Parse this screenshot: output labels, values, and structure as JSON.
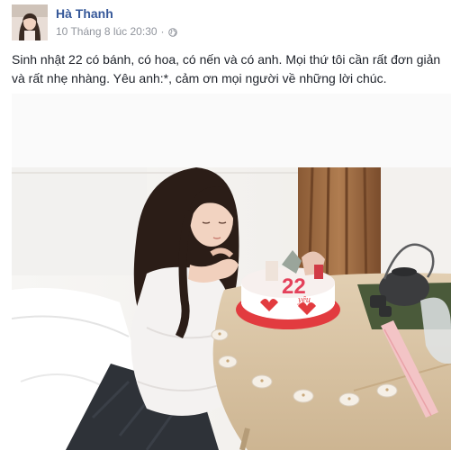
{
  "post": {
    "author": "Hà Thanh",
    "timestamp": "10 Tháng 8 lúc 20:30",
    "separator": "·",
    "privacy_icon": "globe-icon",
    "text_lines": [
      "Sinh nhật 22 có bánh, có hoa, có nến và có anh. Mọi thứ tôi cần rất đơn giản",
      "và rất nhẹ nhàng. Yêu anh:*, cảm ơn mọi người về những lời chúc."
    ]
  },
  "photo": {
    "cake_number": "22",
    "cake_text": "yêu"
  },
  "colors": {
    "author_link": "#365899",
    "meta_text": "#90949c",
    "body_text": "#1d2129"
  }
}
